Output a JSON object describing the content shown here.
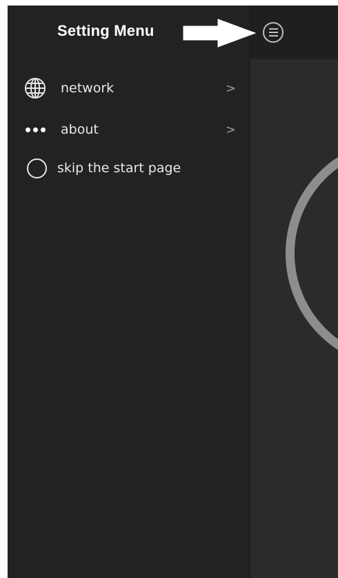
{
  "drawer": {
    "title": "Setting Menu",
    "items": [
      {
        "label": "network",
        "icon": "globe-icon",
        "chevron": ">"
      },
      {
        "label": "about",
        "icon": "more-dots-icon",
        "chevron": ">"
      },
      {
        "label": "skip the start page",
        "icon": "radio-unchecked-icon",
        "checked": false
      }
    ]
  },
  "header": {
    "menu_icon": "hamburger-circle-icon"
  },
  "annotation": {
    "arrow_icon": "arrow-right-icon"
  },
  "colors": {
    "drawer_bg": "#222222",
    "screen_bg": "#2b2b2b",
    "header_bg": "#1f1f1f",
    "ring": "#8d8d8d",
    "text": "#e8e8e8"
  }
}
